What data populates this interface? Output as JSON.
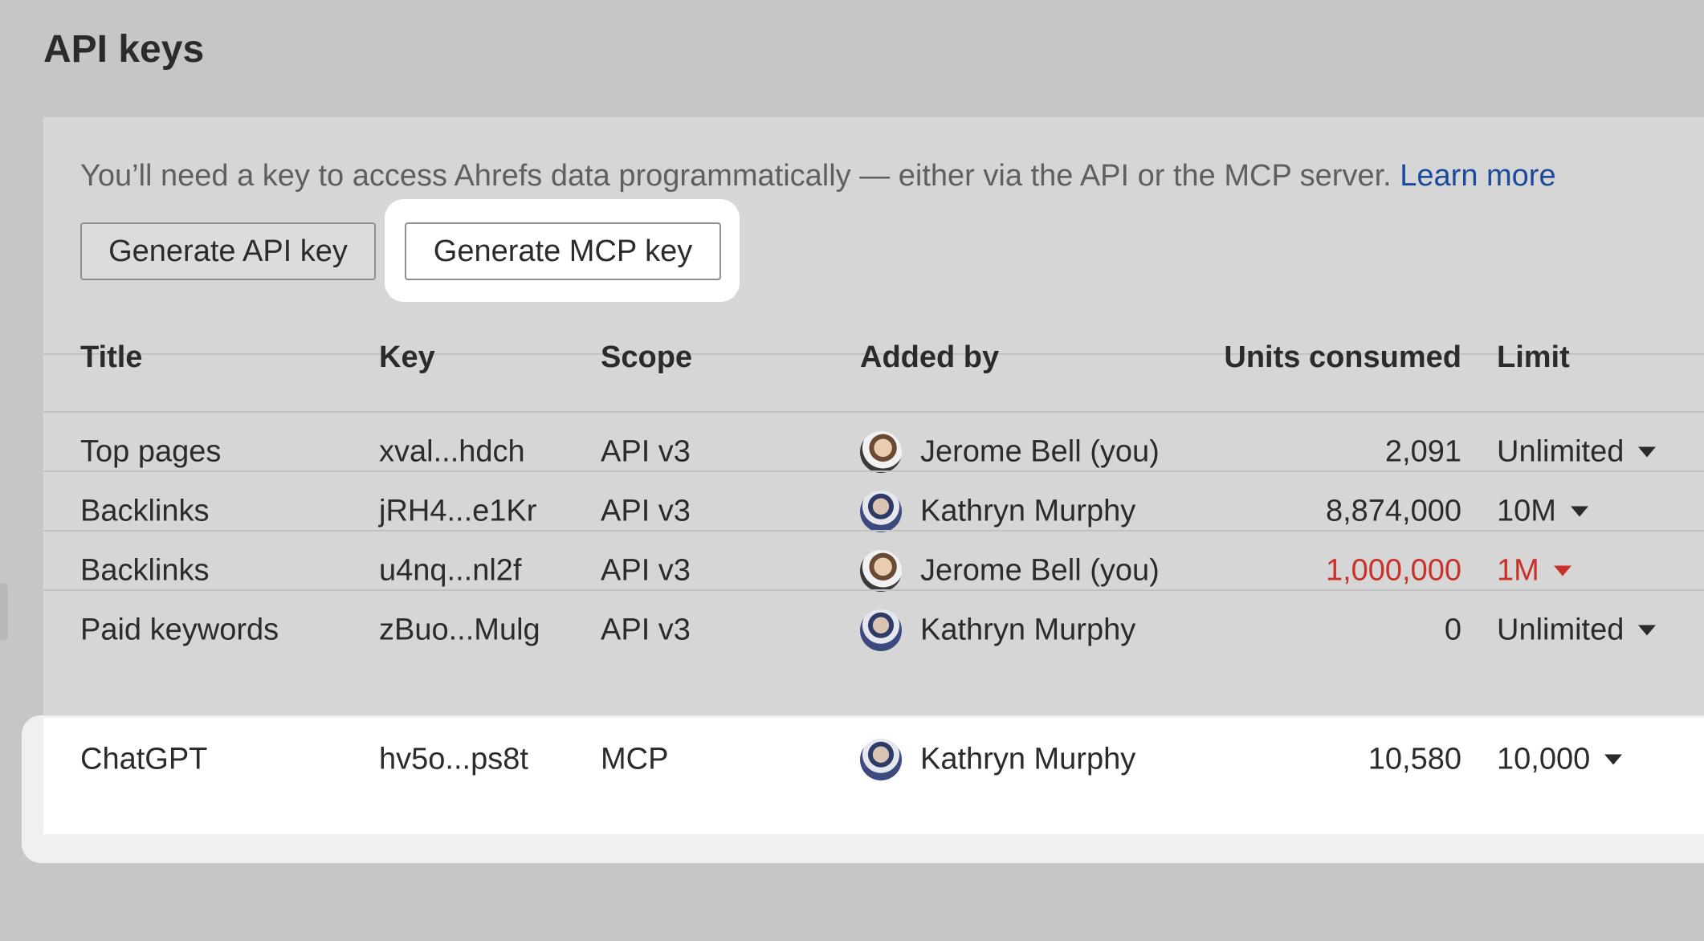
{
  "page": {
    "title": "API keys"
  },
  "intro": {
    "text": "You’ll need a key to access Ahrefs data programmatically — either via the API or the MCP server. ",
    "link": "Learn more"
  },
  "buttons": {
    "generate_api": "Generate API key",
    "generate_mcp": "Generate MCP key"
  },
  "table": {
    "headers": {
      "title": "Title",
      "key": "Key",
      "scope": "Scope",
      "added_by": "Added by",
      "units": "Units consumed",
      "limit": "Limit"
    },
    "rows": [
      {
        "title": "Top pages",
        "key": "xval...hdch",
        "scope": "API v3",
        "added_by": "Jerome Bell (you)",
        "avatar": "jerome-avatar",
        "units": "2,091",
        "limit": "Unlimited",
        "over_limit": false
      },
      {
        "title": "Backlinks",
        "key": "jRH4...e1Kr",
        "scope": "API v3",
        "added_by": "Kathryn Murphy",
        "avatar": "kathryn-avatar",
        "units": "8,874,000",
        "limit": "10M",
        "over_limit": false
      },
      {
        "title": "Backlinks",
        "key": "u4nq...nl2f",
        "scope": "API v3",
        "added_by": "Jerome Bell (you)",
        "avatar": "jerome-avatar",
        "units": "1,000,000",
        "limit": "1M",
        "over_limit": true
      },
      {
        "title": "Paid keywords",
        "key": "zBuo...Mulg",
        "scope": "API v3",
        "added_by": "Kathryn Murphy",
        "avatar": "kathryn-avatar",
        "units": "0",
        "limit": "Unlimited",
        "over_limit": false
      },
      {
        "title": "ChatGPT",
        "key": "hv5o...ps8t",
        "scope": "MCP",
        "added_by": "Kathryn Murphy",
        "avatar": "kathryn-avatar",
        "units": "10,580",
        "limit": "10,000",
        "over_limit": false
      }
    ]
  },
  "colors": {
    "link": "#1a4a9c",
    "warning": "#c8322b",
    "panel": "#d6d6d6",
    "background": "#c5c6c8",
    "highlight": "#ffffff"
  },
  "icons": {
    "limit_dropdown": "caret-down-icon"
  }
}
